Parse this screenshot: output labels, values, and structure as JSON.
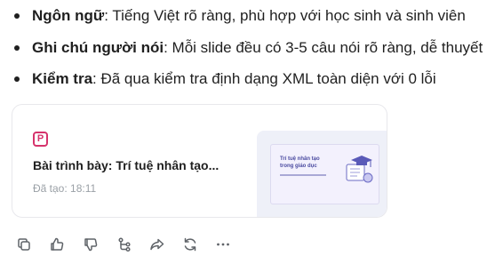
{
  "bullets": [
    {
      "label": "Ngôn ngữ",
      "text": ": Tiếng Việt rõ ràng, phù hợp với học sinh và sinh viên"
    },
    {
      "label": "Ghi chú người nói",
      "text": ": Mỗi slide đều có 3-5 câu nói rõ ràng, dễ thuyết"
    },
    {
      "label": "Kiểm tra",
      "text": ": Đã qua kiểm tra định dạng XML toàn diện với 0 lỗi"
    }
  ],
  "card": {
    "icon": "presentation-file-icon",
    "icon_glyph": "P",
    "title": "Bài trình bày: Trí tuệ nhân tạo...",
    "time": "Đã tạo: 18:11",
    "thumbnail": {
      "slide_title": "Trí tuệ nhân tạo trong giáo dục"
    }
  },
  "actions": [
    {
      "name": "copy-icon"
    },
    {
      "name": "thumbs-up-icon"
    },
    {
      "name": "thumbs-down-icon"
    },
    {
      "name": "branch-icon"
    },
    {
      "name": "share-icon"
    },
    {
      "name": "regenerate-icon"
    },
    {
      "name": "more-icon"
    }
  ],
  "colors": {
    "accent_pink": "#d6336c",
    "muted_text": "#9aa0a6",
    "slide_bg": "#f3f1fd"
  }
}
